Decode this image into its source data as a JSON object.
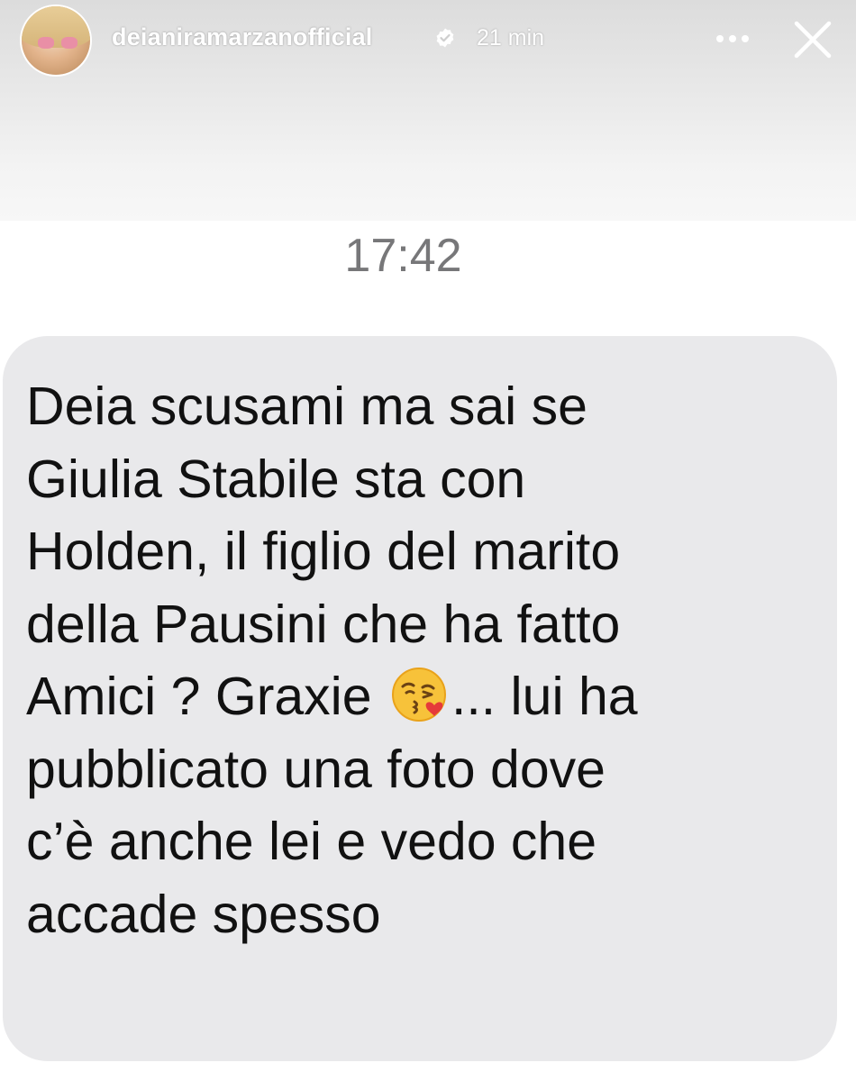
{
  "story": {
    "username": "deianiramarzanofficial",
    "time_ago": "21 min",
    "icons": {
      "avatar": "profile-photo",
      "verified": "verified-badge-icon",
      "more": "more-options-icon",
      "close": "close-icon"
    }
  },
  "chat": {
    "time": "17:42",
    "message": {
      "line1": "Deia scusami ma sai se\nGiulia Stabile sta con\nHolden, il figlio del marito\ndella Pausini che ha fatto\nAmici ? Graxie ",
      "emoji": "face-blowing-a-kiss-emoji",
      "line2": "... lui ha\npubblicato una foto dove\nc’è anche lei e vedo che\naccade spesso"
    },
    "colors": {
      "bubble": "#e9e9eb",
      "text": "#111111",
      "time": "#777779"
    }
  }
}
